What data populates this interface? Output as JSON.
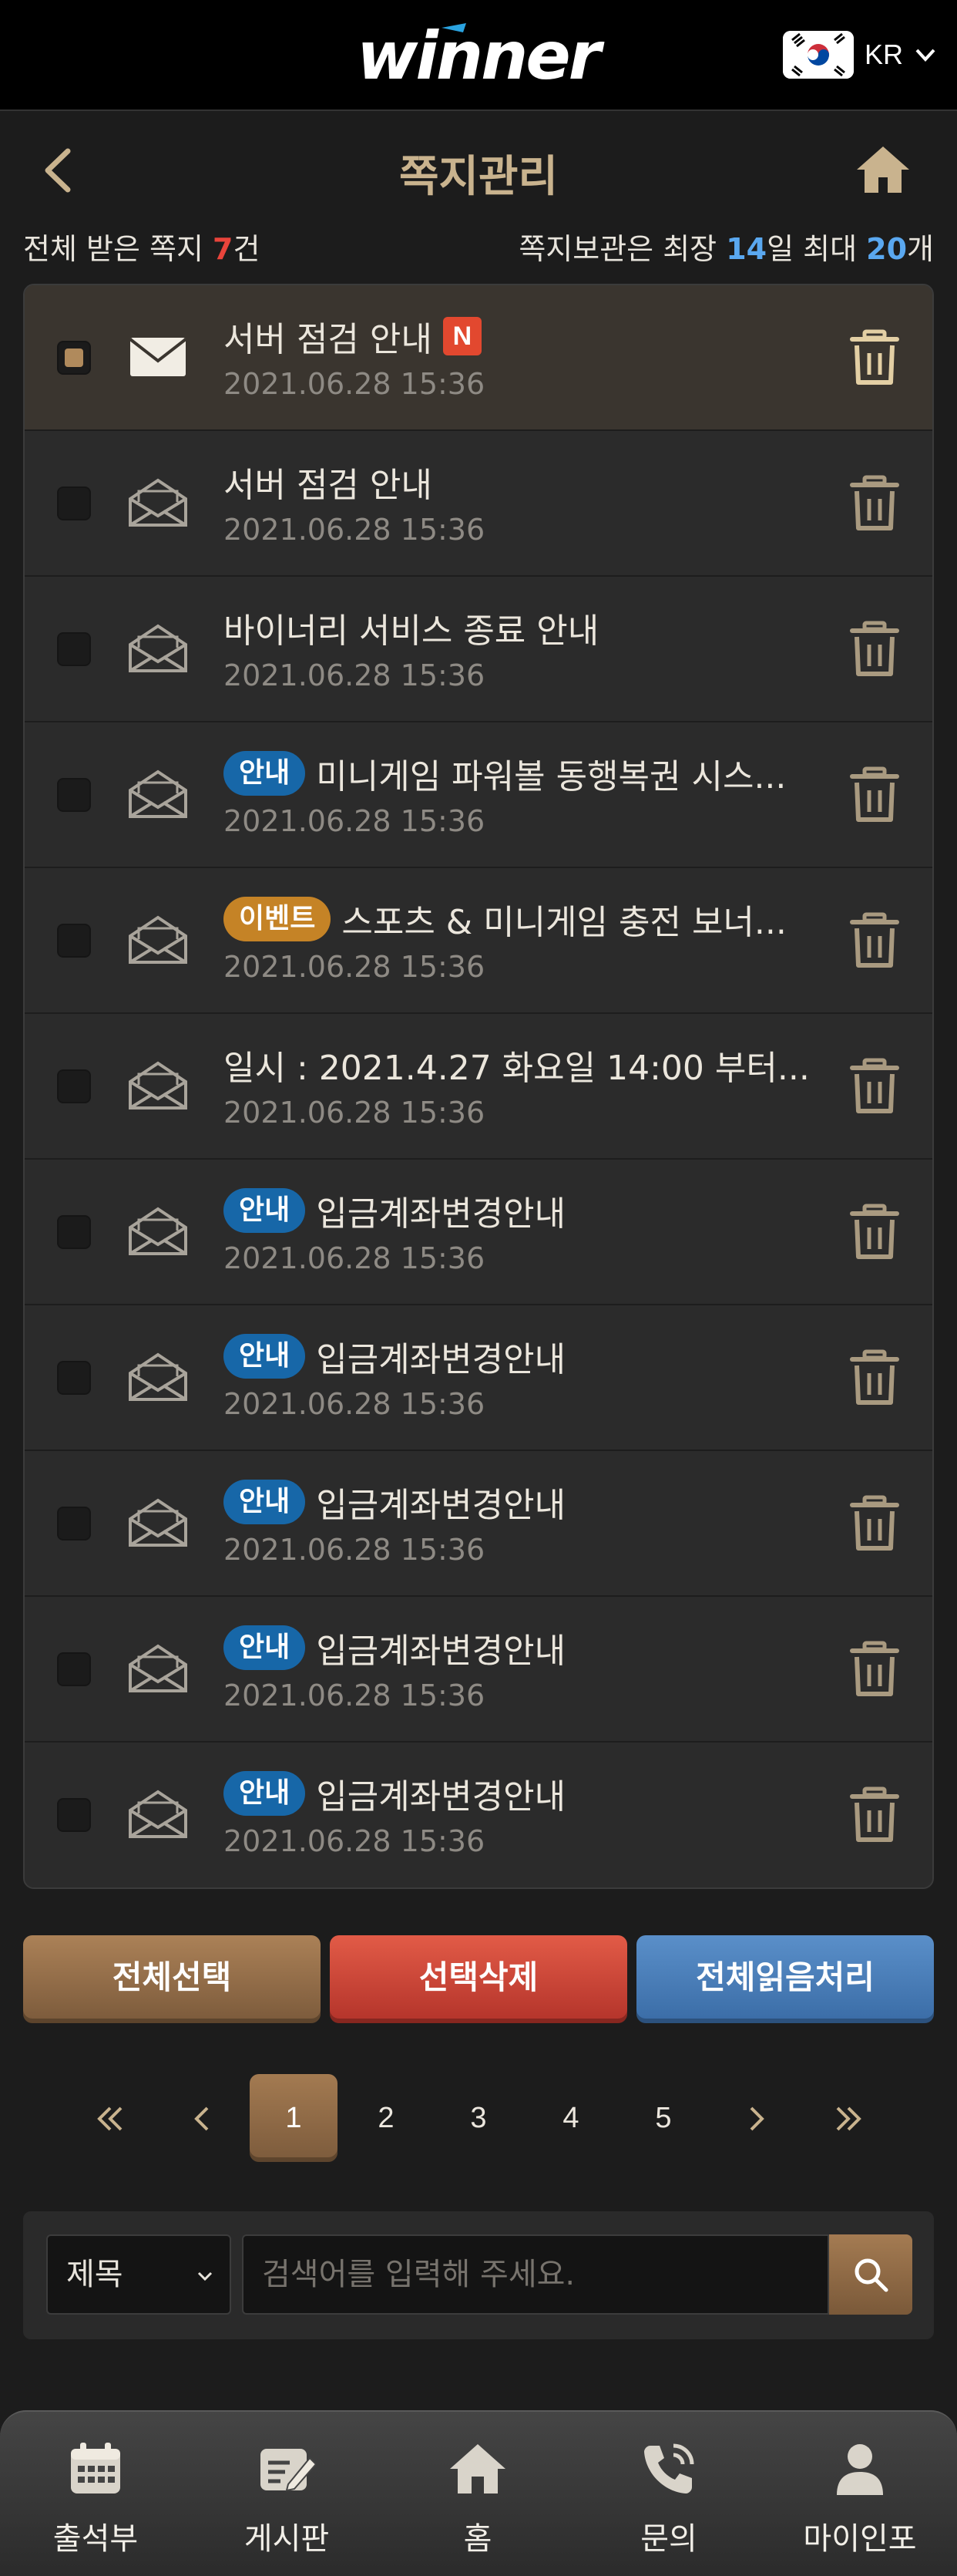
{
  "header": {
    "logo_text": "winner",
    "lang_code": "KR"
  },
  "page": {
    "title": "쪽지관리",
    "summary_prefix": "전체 받은 쪽지 ",
    "summary_count": "7",
    "summary_suffix": "건",
    "retention_prefix": "쪽지보관은 최장 ",
    "retention_days": "14",
    "retention_mid": "일 최대 ",
    "retention_max": "20",
    "retention_suffix": "개"
  },
  "messages": [
    {
      "title": "서버 점검 안내",
      "date": "2021.06.28 15:36",
      "badge": "",
      "is_new": true,
      "unread": true
    },
    {
      "title": "서버 점검 안내",
      "date": "2021.06.28 15:36",
      "badge": "",
      "is_new": false,
      "unread": false
    },
    {
      "title": "바이너리 서비스 종료 안내",
      "date": "2021.06.28 15:36",
      "badge": "",
      "is_new": false,
      "unread": false
    },
    {
      "title": "미니게임 파워볼 동행복권 시스...",
      "date": "2021.06.28 15:36",
      "badge": "안내",
      "badge_type": "info",
      "is_new": false,
      "unread": false
    },
    {
      "title": "스포츠 & 미니게임 충전 보너...",
      "date": "2021.06.28 15:36",
      "badge": "이벤트",
      "badge_type": "event",
      "is_new": false,
      "unread": false
    },
    {
      "title": "일시 : 2021.4.27 화요일 14:00 부터...",
      "date": "2021.06.28 15:36",
      "badge": "",
      "is_new": false,
      "unread": false
    },
    {
      "title": "입금계좌변경안내",
      "date": "2021.06.28 15:36",
      "badge": "안내",
      "badge_type": "info",
      "is_new": false,
      "unread": false
    },
    {
      "title": "입금계좌변경안내",
      "date": "2021.06.28 15:36",
      "badge": "안내",
      "badge_type": "info",
      "is_new": false,
      "unread": false
    },
    {
      "title": "입금계좌변경안내",
      "date": "2021.06.28 15:36",
      "badge": "안내",
      "badge_type": "info",
      "is_new": false,
      "unread": false
    },
    {
      "title": "입금계좌변경안내",
      "date": "2021.06.28 15:36",
      "badge": "안내",
      "badge_type": "info",
      "is_new": false,
      "unread": false
    },
    {
      "title": "입금계좌변경안내",
      "date": "2021.06.28 15:36",
      "badge": "안내",
      "badge_type": "info",
      "is_new": false,
      "unread": false
    }
  ],
  "new_badge_label": "N",
  "actions": {
    "select_all": "전체선택",
    "delete_selected": "선택삭제",
    "mark_all_read": "전체읽음처리"
  },
  "pagination": {
    "pages": [
      "1",
      "2",
      "3",
      "4",
      "5"
    ],
    "current": "1"
  },
  "search": {
    "field_selected": "제목",
    "placeholder": "검색어를 입력해 주세요."
  },
  "bottom_nav": [
    {
      "label": "출석부",
      "icon": "calendar-icon"
    },
    {
      "label": "게시판",
      "icon": "board-edit-icon"
    },
    {
      "label": "홈",
      "icon": "home-icon"
    },
    {
      "label": "문의",
      "icon": "phone-icon"
    },
    {
      "label": "마이인포",
      "icon": "user-icon"
    }
  ],
  "colors": {
    "accent_gold": "#c9b38e",
    "count_red": "#e9443b",
    "count_blue": "#5aa8f0",
    "badge_info": "#1767a8",
    "badge_event": "#c58326",
    "new_badge": "#e2482f"
  }
}
